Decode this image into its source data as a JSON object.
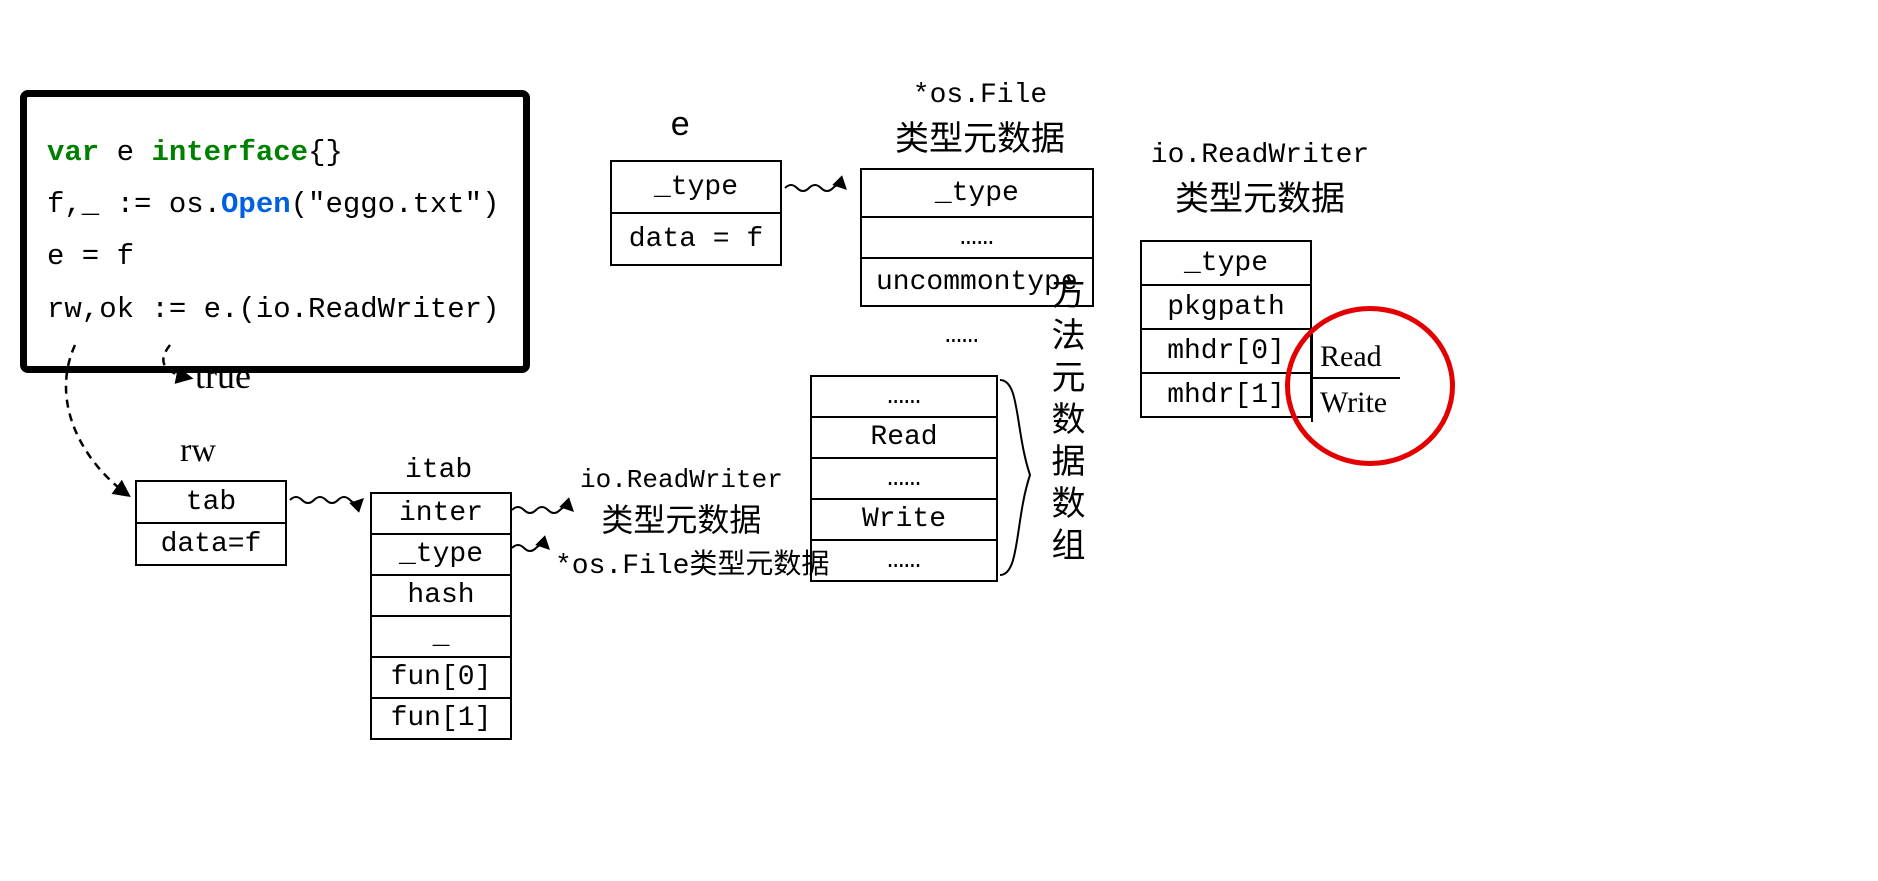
{
  "code": {
    "l1_var": "var",
    "l1_e": " e ",
    "l1_interface": "interface",
    "l1_tail": "{}",
    "l2_pre": "f,_ := os.",
    "l2_open": "Open",
    "l2_post": "(\"eggo.txt\")",
    "l3": "e = f",
    "l4": "rw,ok := e.(io.ReadWriter)"
  },
  "labels": {
    "true_val": "true",
    "rw_label": "rw",
    "e_label": "e",
    "itab_label": "itab",
    "osfile_header": "*os.File",
    "type_meta": "类型元数据",
    "io_rw_header": "io.ReadWriter",
    "methods_array": "方法元数据数组",
    "io_rw_meta": "io.ReadWriter",
    "osfile_meta": "*os.File类型元数据"
  },
  "e_box": {
    "r1": "_type",
    "r2": "data = f"
  },
  "rw_box": {
    "r1": "tab",
    "r2": "data=f"
  },
  "itab_box": {
    "r1": "inter",
    "r2": "_type",
    "r3": "hash",
    "r4": "_",
    "r5": "fun[0]",
    "r6": "fun[1]"
  },
  "osfile_box": {
    "r1": "_type",
    "r2": "……",
    "r3": "uncommontype"
  },
  "osfile_ellipsis": "……",
  "methods_box": {
    "r1": "……",
    "r2": "Read",
    "r3": "……",
    "r4": "Write",
    "r5": "……"
  },
  "iorw_box": {
    "r1": "_type",
    "r2": "pkgpath",
    "r3": "mhdr[0]",
    "r4": "mhdr[1]"
  },
  "rw_methods": {
    "m1": "Read",
    "m2": "Write"
  }
}
